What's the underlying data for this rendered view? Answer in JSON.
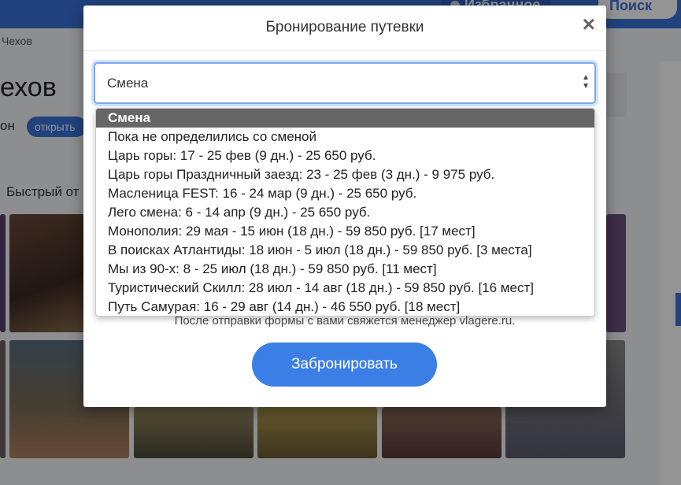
{
  "background": {
    "favorites_label": "Избранное",
    "search_label": "Поиск",
    "breadcrumb": "Чехов",
    "title": "ехов",
    "region_label": "он",
    "open_button": "открыть",
    "quick_label": "Быстрый от"
  },
  "modal": {
    "title": "Бронирование путевки",
    "close_icon": "×",
    "select": {
      "value": "Смена",
      "options": [
        "Смена",
        "Пока не определились со сменой",
        "Царь горы: 17 - 25 фев (9 дн.) - 25 650 руб.",
        "Царь горы Праздничный заезд: 23 - 25 фев (3 дн.) - 9 975 руб.",
        "Масленица FEST: 16 - 24 мар (9 дн.) - 25 650 руб.",
        "Лего смена: 6 - 14 апр (9 дн.) - 25 650 руб.",
        "Монополия: 29 мая - 15 июн (18 дн.) - 59 850 руб. [17 мест]",
        "В поисках Атлантиды: 18 июн - 5 июл (18 дн.) - 59 850 руб. [3 места]",
        "Мы из 90-х: 8 - 25 июл (18 дн.) - 59 850 руб. [11 мест]",
        "Туристический Скилл: 28 июл - 14 авг (18 дн.) - 59 850 руб. [16 мест]",
        "Путь Самурая: 16 - 29 авг (14 дн.) - 46 550 руб. [18 мест]"
      ],
      "selected_index": 0
    },
    "notice": "После отправки формы с вами свяжется менеджер vlagere.ru.",
    "submit_label": "Забронировать"
  },
  "colors": {
    "accent": "#3b7fe6",
    "topbar": "#3b72d9",
    "selected_option_bg": "#666666"
  }
}
